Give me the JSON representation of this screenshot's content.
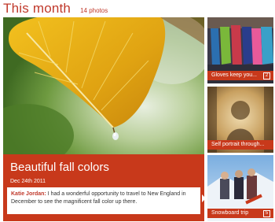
{
  "header": {
    "title": "This month",
    "count": "14 photos"
  },
  "feature": {
    "title": "Beautiful fall colors",
    "date": "Dec 24th 2011",
    "comment_author": "Katie Jordan:",
    "comment_text": " I had a wonderful opportunity to travel to New England in December to see the magnificent fall color up there."
  },
  "tiles": [
    {
      "label": "Gloves keep you...",
      "badge": "2"
    },
    {
      "label": "Self portrait through..."
    },
    {
      "label": "Snowboard trip",
      "badge": "5"
    }
  ],
  "colors": {
    "accent": "#c8391b",
    "title_text": "#c0392b"
  }
}
